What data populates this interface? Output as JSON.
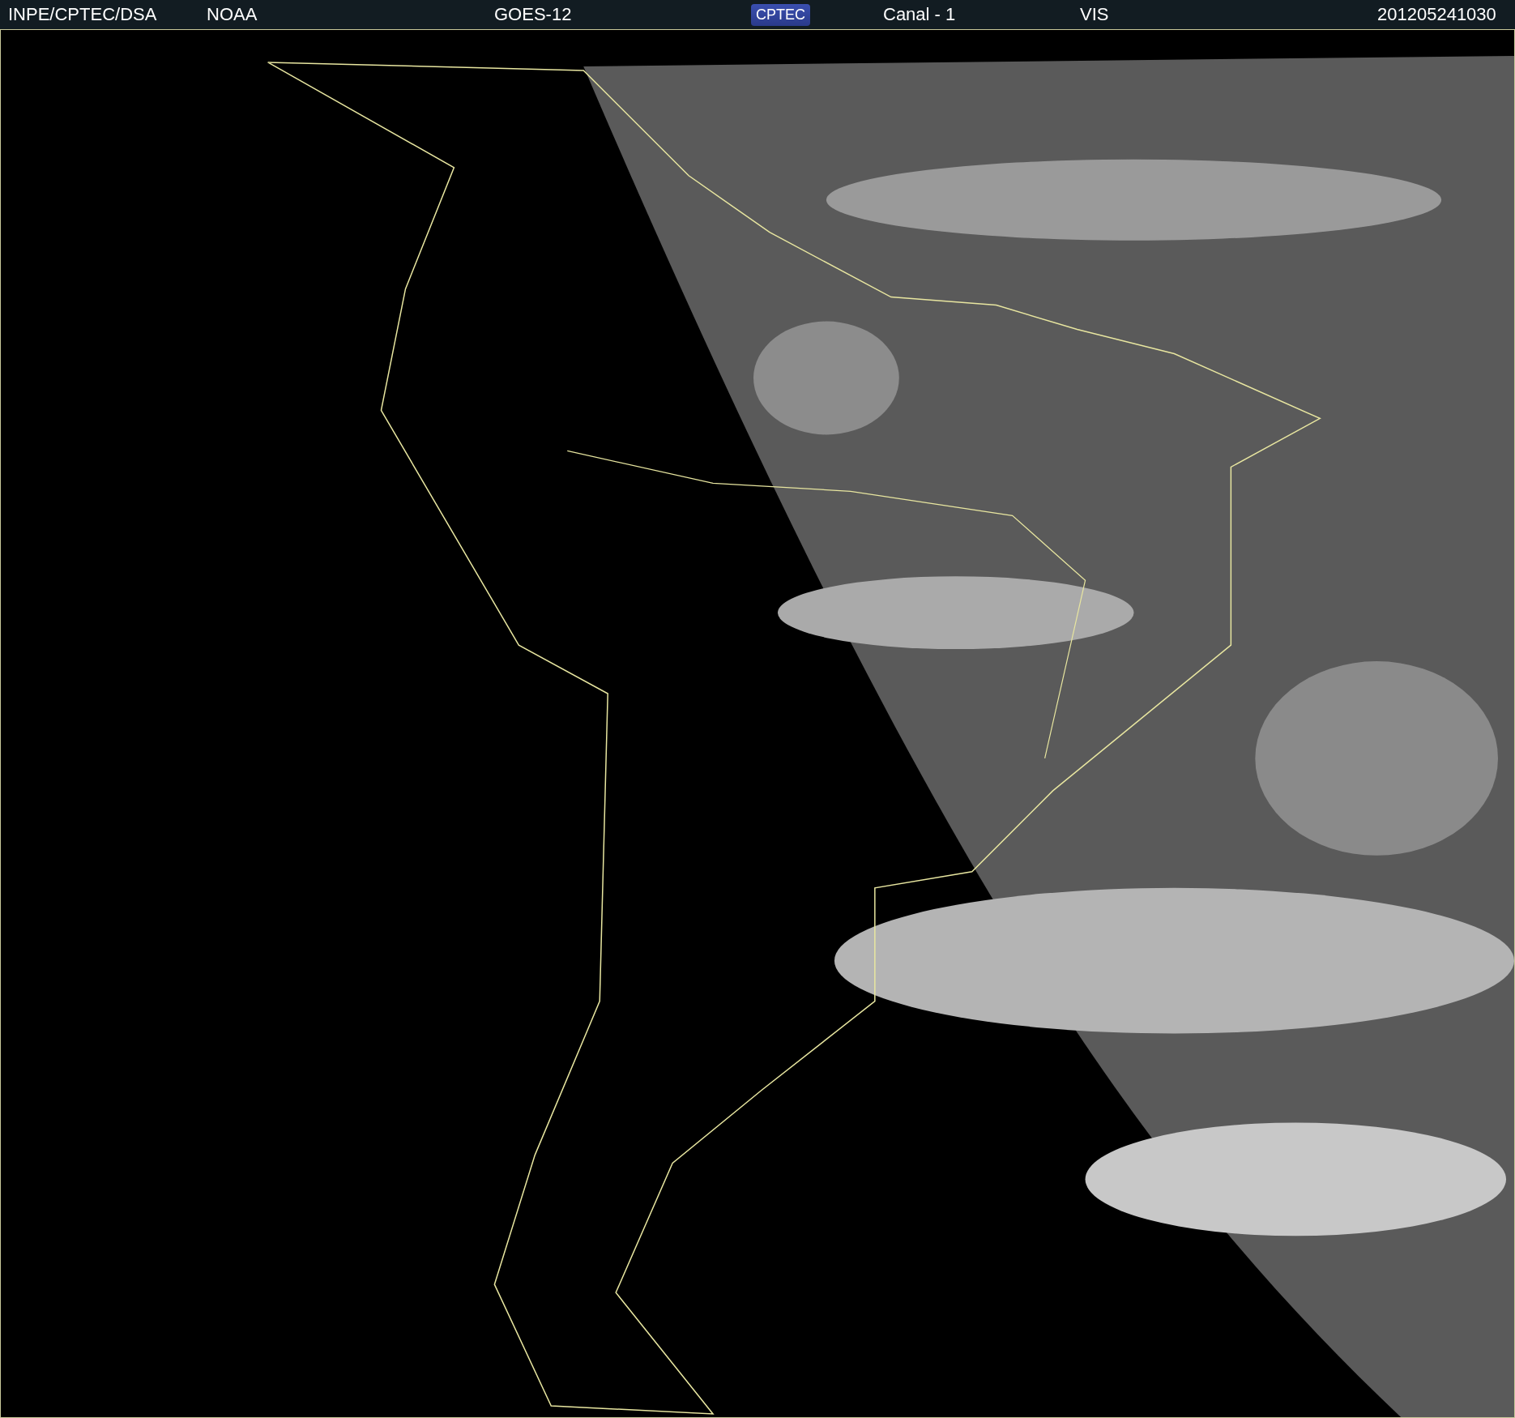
{
  "header": {
    "items": [
      {
        "kind": "text",
        "text": "INPE/CPTEC/DSA"
      },
      {
        "kind": "text",
        "text": "NOAA"
      },
      {
        "kind": "text",
        "text": "GOES-12"
      },
      {
        "kind": "logo",
        "text": "CPTEC"
      },
      {
        "kind": "text",
        "text": "Canal - 1"
      },
      {
        "kind": "text",
        "text": "VIS"
      },
      {
        "kind": "text",
        "text": "201205241030"
      }
    ]
  }
}
